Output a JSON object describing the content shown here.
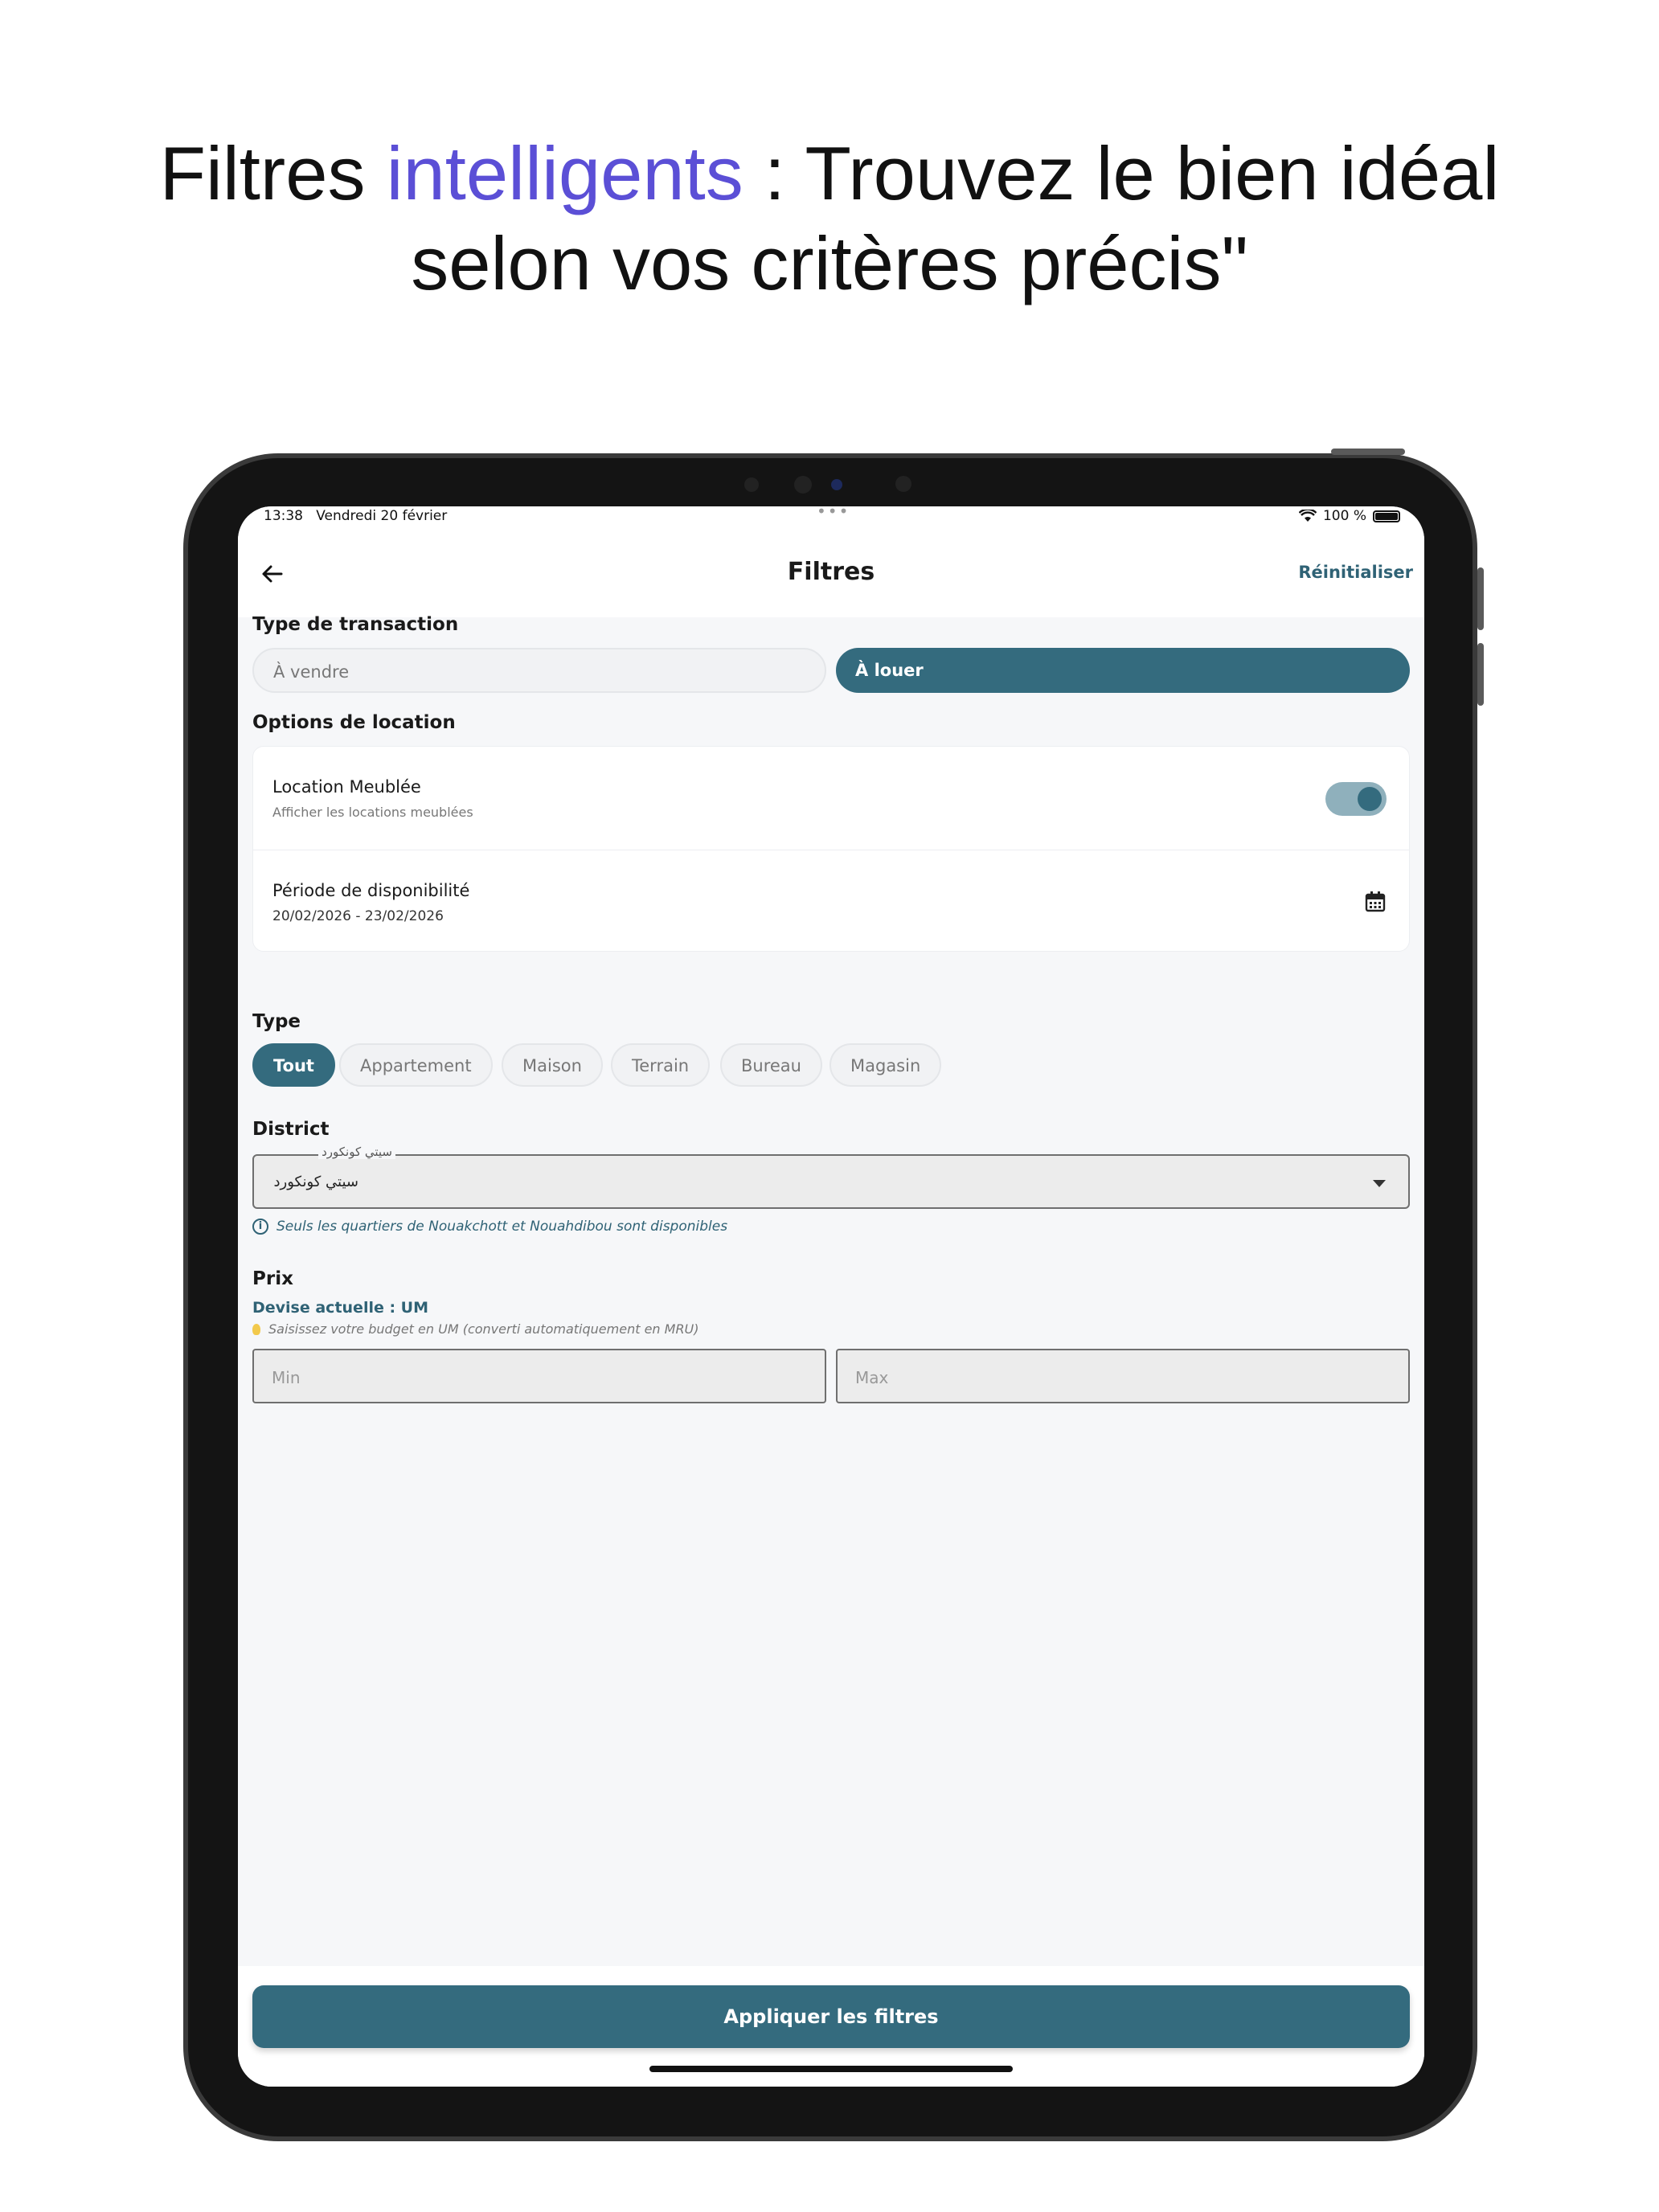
{
  "headline": {
    "prefix": "Filtres ",
    "accent": "intelligents",
    "line1_rest": " : Trouvez le bien idéal",
    "line2": "selon vos critères précis\""
  },
  "colors": {
    "accent": "#5b4fd6",
    "primary": "#346b7e"
  },
  "statusbar": {
    "time": "13:38",
    "date": "Vendredi 20 février",
    "dots": "•••",
    "battery": "100 %",
    "icons": [
      "wifi-icon",
      "battery-icon"
    ]
  },
  "appbar": {
    "title": "Filtres",
    "reset_label": "Réinitialiser",
    "back_icon": "arrow-left-icon"
  },
  "transaction": {
    "title": "Type de transaction",
    "options": [
      "À vendre",
      "À louer"
    ],
    "selected": "À louer"
  },
  "rental_options": {
    "title": "Options de location",
    "furnished": {
      "title": "Location Meublée",
      "subtitle": "Afficher les locations meublées",
      "enabled": true
    },
    "availability": {
      "title": "Période de disponibilité",
      "value": "20/02/2026 - 23/02/2026",
      "icon": "calendar-icon"
    }
  },
  "type": {
    "title": "Type",
    "chips": [
      "Tout",
      "Appartement",
      "Maison",
      "Terrain",
      "Bureau",
      "Magasin"
    ],
    "selected": "Tout"
  },
  "district": {
    "title": "District",
    "label": "سيتي كونكورد",
    "value": "سيتي كونكورد",
    "hint": "Seuls les quartiers de Nouakchott et Nouahdibou sont disponibles"
  },
  "price": {
    "title": "Prix",
    "currency": "Devise actuelle : UM",
    "hint": "Saisissez votre budget en UM (converti automatiquement en MRU)",
    "min_placeholder": "Min",
    "max_placeholder": "Max"
  },
  "apply_label": "Appliquer les filtres"
}
